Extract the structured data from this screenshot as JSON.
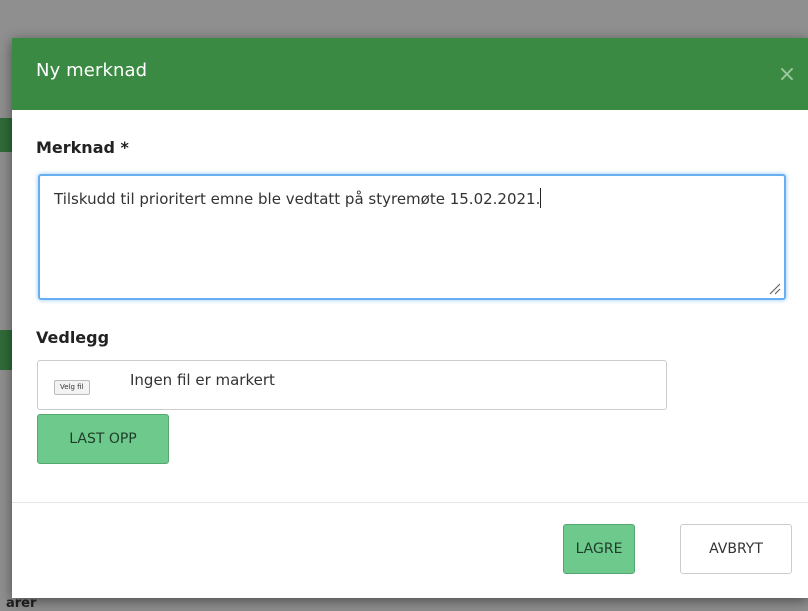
{
  "background": {
    "partial_text": "arer"
  },
  "modal": {
    "title": "Ny merknad",
    "close_label": "×",
    "note_label": "Merknad *",
    "note_value": "Tilskudd til prioritert emne ble vedtatt på styremøte 15.02.2021.",
    "attachment_label": "Vedlegg",
    "file_choose_label": "Velg fil",
    "file_status": "Ingen fil er markert",
    "upload_label": "LAST OPP",
    "save_label": "LAGRE",
    "cancel_label": "AVBRYT"
  },
  "colors": {
    "header": "#3b8a43",
    "button_green": "#6ec98c",
    "focus_border": "#66aff0"
  }
}
